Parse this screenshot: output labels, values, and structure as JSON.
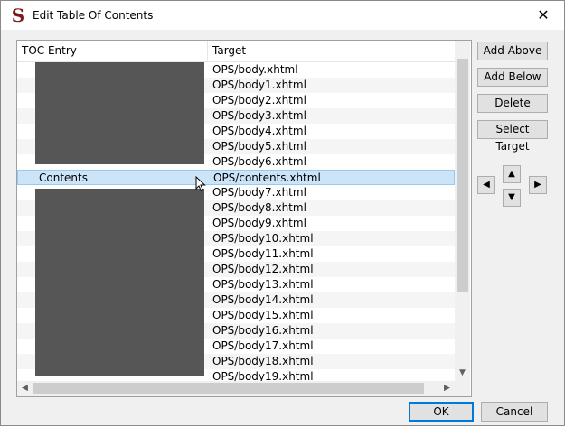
{
  "window": {
    "title": "Edit Table Of Contents",
    "close_glyph": "✕",
    "app_icon_glyph": "S"
  },
  "tree": {
    "columns": {
      "toc": "TOC Entry",
      "target": "Target"
    },
    "rows": [
      {
        "toc": "",
        "target": "OPS/body.xhtml"
      },
      {
        "toc": "",
        "target": "OPS/body1.xhtml"
      },
      {
        "toc": "",
        "target": "OPS/body2.xhtml"
      },
      {
        "toc": "",
        "target": "OPS/body3.xhtml"
      },
      {
        "toc": "",
        "target": "OPS/body4.xhtml"
      },
      {
        "toc": "",
        "target": "OPS/body5.xhtml"
      },
      {
        "toc": "",
        "target": "OPS/body6.xhtml"
      },
      {
        "toc": "Contents",
        "target": "OPS/contents.xhtml",
        "selected": true
      },
      {
        "toc": "",
        "target": "OPS/body7.xhtml"
      },
      {
        "toc": "",
        "target": "OPS/body8.xhtml"
      },
      {
        "toc": "",
        "target": "OPS/body9.xhtml"
      },
      {
        "toc": "",
        "target": "OPS/body10.xhtml"
      },
      {
        "toc": "",
        "target": "OPS/body11.xhtml"
      },
      {
        "toc": "",
        "target": "OPS/body12.xhtml"
      },
      {
        "toc": "",
        "target": "OPS/body13.xhtml"
      },
      {
        "toc": "",
        "target": "OPS/body14.xhtml"
      },
      {
        "toc": "",
        "target": "OPS/body15.xhtml"
      },
      {
        "toc": "",
        "target": "OPS/body16.xhtml"
      },
      {
        "toc": "",
        "target": "OPS/body17.xhtml"
      },
      {
        "toc": "",
        "target": "OPS/body18.xhtml"
      },
      {
        "toc": "",
        "target": "OPS/body19.xhtml"
      }
    ]
  },
  "side_buttons": {
    "add_above": "Add Above",
    "add_below": "Add Below",
    "delete": "Delete",
    "select_target": "Select Target"
  },
  "move_buttons": {
    "up": "▲",
    "down": "▼",
    "left": "◀",
    "right": "▶"
  },
  "footer": {
    "ok": "OK",
    "cancel": "Cancel"
  },
  "colors": {
    "selection": "#cce4f7",
    "redaction": "#565656",
    "default_button_border": "#0078d7"
  }
}
